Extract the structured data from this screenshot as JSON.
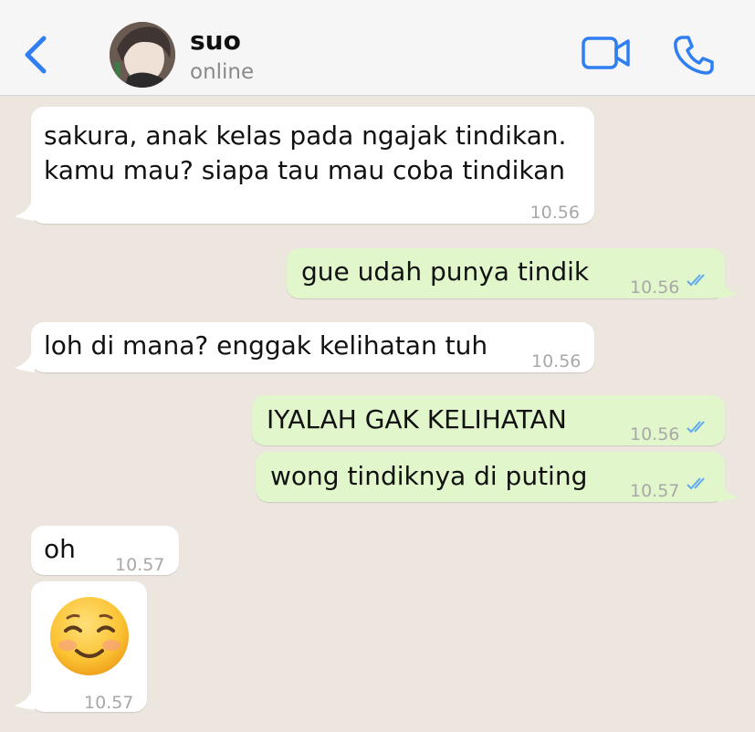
{
  "header": {
    "contact_name": "suo",
    "contact_status": "online"
  },
  "icons": {
    "back": "chevron-left-icon",
    "video": "video-camera-icon",
    "call": "phone-icon",
    "read_receipt": "double-check-icon"
  },
  "colors": {
    "accent": "#2f7ef2",
    "incoming_bubble": "#ffffff",
    "outgoing_bubble": "#e1f7cb",
    "chat_background": "#ece6df",
    "read_ticks": "#5fa9f2"
  },
  "messages": [
    {
      "direction": "incoming",
      "lines": [
        "sakura, anak kelas pada ngajak tindikan.",
        "kamu mau? siapa tau mau coba tindikan"
      ],
      "time": "10.56"
    },
    {
      "direction": "outgoing",
      "text": "gue udah punya tindik",
      "time": "10.56"
    },
    {
      "direction": "incoming",
      "text": "loh di mana? enggak kelihatan tuh",
      "time": "10.56"
    },
    {
      "direction": "outgoing",
      "text": "IYALAH GAK KELIHATAN",
      "time": "10.56"
    },
    {
      "direction": "outgoing",
      "text": "wong tindiknya di puting",
      "time": "10.57"
    },
    {
      "direction": "incoming",
      "text": "oh",
      "time": "10.57"
    },
    {
      "direction": "incoming",
      "emoji": "smiling-face-with-closed-eyes-emoji",
      "time": "10.57"
    }
  ]
}
